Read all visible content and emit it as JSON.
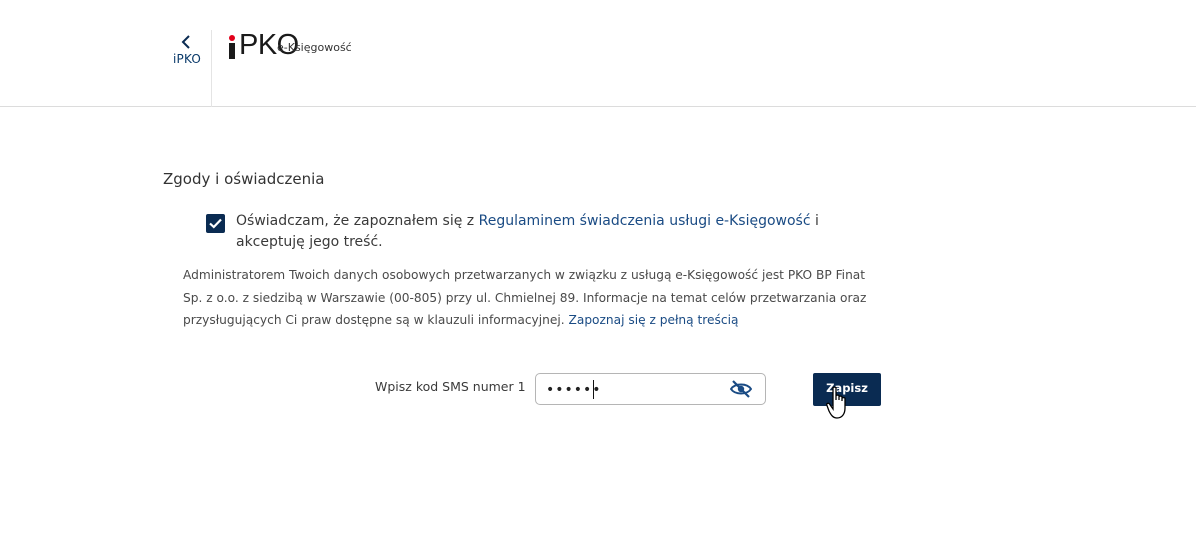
{
  "header": {
    "back_label": "iPKO",
    "logo_text": "PKO",
    "logo_subtitle": "e-Księgowość"
  },
  "section": {
    "title": "Zgody i oświadczenia"
  },
  "consent": {
    "checked": true,
    "text_before": "Oświadczam, że zapoznałem się z ",
    "link_text": "Regulaminem świadczenia usługi e-Księgowość",
    "text_after": " i akceptuję jego treść."
  },
  "admin_info": {
    "text": "Administratorem Twoich danych osobowych przetwarzanych w związku z usługą e-Księgowość jest PKO BP Finat Sp. z o.o. z siedzibą w Warszawie (00-805) przy ul. Chmielnej 89. Informacje na temat celów przetwarzania oraz przysługujących Ci praw dostępne są w klauzuli informacyjnej. ",
    "link_text": "Zapoznaj się z pełną treścią"
  },
  "sms": {
    "label": "Wpisz kod SMS numer 1",
    "value": "••••••"
  },
  "actions": {
    "save_label": "Zapisz"
  },
  "colors": {
    "primary": "#0a2b52",
    "link": "#1a4b84",
    "brand_red": "#e2001a"
  },
  "icons": {
    "back": "chevron-left-icon",
    "checkbox": "checkmark-icon",
    "password_toggle": "eye-slash-icon",
    "pointer": "hand-cursor-icon"
  }
}
